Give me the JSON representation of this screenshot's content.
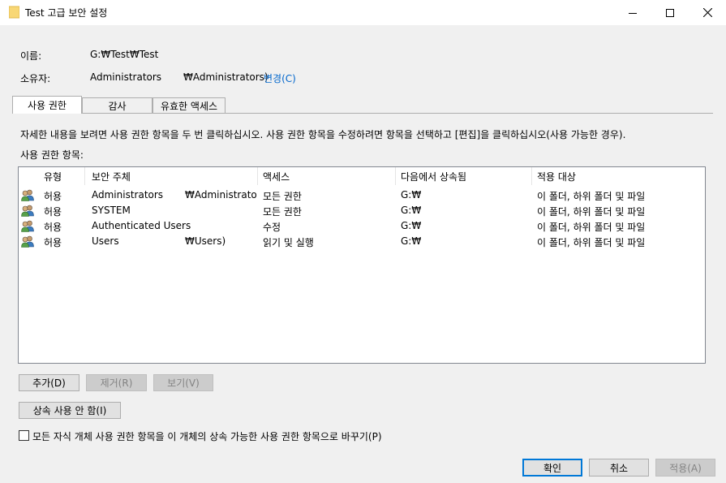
{
  "window": {
    "title": "Test 고급 보안 설정",
    "folder_color": "#f8d775"
  },
  "info": {
    "name_label": "이름:",
    "name_value": "G:₩Test₩Test",
    "owner_label": "소유자:",
    "owner_value": "Administrators",
    "owner_suffix": "₩Administrators)",
    "change_link": "변경(C)"
  },
  "tabs": [
    {
      "label": "사용 권한"
    },
    {
      "label": "감사"
    },
    {
      "label": "유효한 액세스"
    }
  ],
  "instructions": "자세한 내용을 보려면 사용 권한 항목을 두 번 클릭하십시오. 사용 권한 항목을 수정하려면 항목을 선택하고 [편집]을 클릭하십시오(사용 가능한 경우).",
  "entries_label": "사용 권한 항목:",
  "columns": [
    "유형",
    "보안 주체",
    "액세스",
    "다음에서 상속됨",
    "적용 대상"
  ],
  "rows": [
    {
      "type": "허용",
      "principal": "Administrators",
      "principal_suffix": "₩Administrato...",
      "access": "모든 권한",
      "inherited": "G:₩",
      "applies": "이 폴더, 하위 폴더 및 파일"
    },
    {
      "type": "허용",
      "principal": "SYSTEM",
      "principal_suffix": "",
      "access": "모든 권한",
      "inherited": "G:₩",
      "applies": "이 폴더, 하위 폴더 및 파일"
    },
    {
      "type": "허용",
      "principal": "Authenticated Users",
      "principal_suffix": "",
      "access": "수정",
      "inherited": "G:₩",
      "applies": "이 폴더, 하위 폴더 및 파일"
    },
    {
      "type": "허용",
      "principal": "Users",
      "principal_suffix": "₩Users)",
      "access": "읽기 및 실행",
      "inherited": "G:₩",
      "applies": "이 폴더, 하위 폴더 및 파일"
    }
  ],
  "buttons": {
    "add": "추가(D)",
    "remove": "제거(R)",
    "view": "보기(V)",
    "disable_inheritance": "상속 사용 안 함(I)",
    "ok": "확인",
    "cancel": "취소",
    "apply": "적용(A)"
  },
  "replace_checkbox": "모든 자식 개체 사용 권한 항목을 이 개체의 상속 가능한 사용 권한 항목으로 바꾸기(P)",
  "colors": {
    "accent": "#0078d7",
    "link": "#0066cc"
  }
}
